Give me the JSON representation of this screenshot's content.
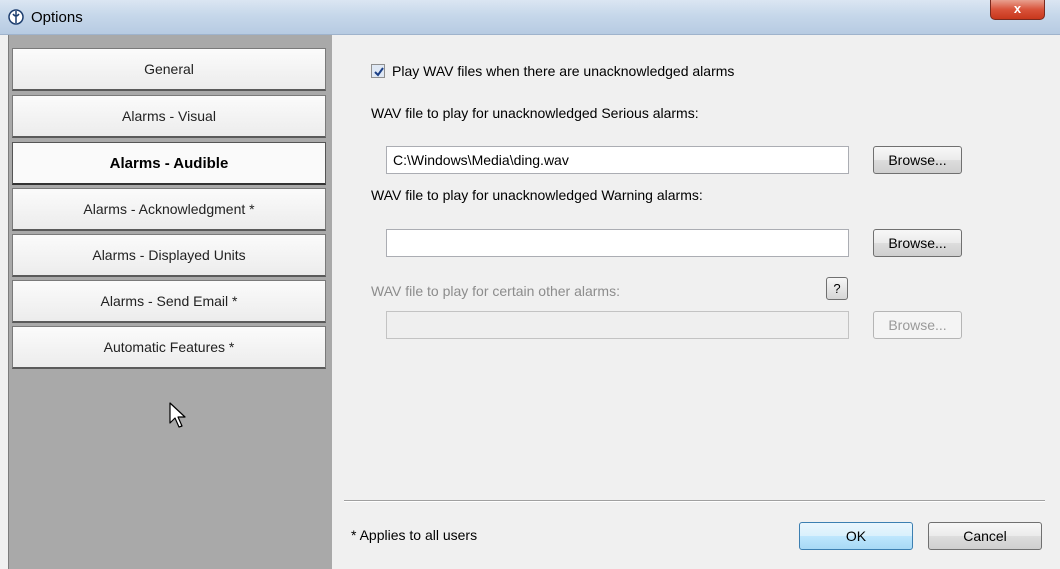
{
  "window": {
    "title": "Options",
    "close_label": "x"
  },
  "sidebar": {
    "items": [
      {
        "label": "General"
      },
      {
        "label": "Alarms - Visual"
      },
      {
        "label": "Alarms - Audible",
        "active": true
      },
      {
        "label": "Alarms - Acknowledgment *"
      },
      {
        "label": "Alarms - Displayed Units"
      },
      {
        "label": "Alarms - Send Email *"
      },
      {
        "label": "Automatic Features *"
      }
    ]
  },
  "audible": {
    "play_wav_checkbox": {
      "label": "Play WAV files when there are unacknowledged alarms",
      "checked": true
    },
    "serious": {
      "label": "WAV file to play for unacknowledged Serious alarms:",
      "value": "C:\\Windows\\Media\\ding.wav",
      "browse_label": "Browse..."
    },
    "warning": {
      "label": "WAV file to play for unacknowledged Warning alarms:",
      "value": "",
      "browse_label": "Browse..."
    },
    "other": {
      "label": "WAV file to play for certain other alarms:",
      "help_label": "?",
      "value": "",
      "browse_label": "Browse...",
      "enabled": false
    }
  },
  "footer": {
    "note": "* Applies to all users",
    "ok_label": "OK",
    "cancel_label": "Cancel"
  },
  "colors": {
    "sidebar_bg": "#a9a9a9",
    "dialog_bg": "#f0f0f0",
    "close_button": "#c7371c"
  }
}
